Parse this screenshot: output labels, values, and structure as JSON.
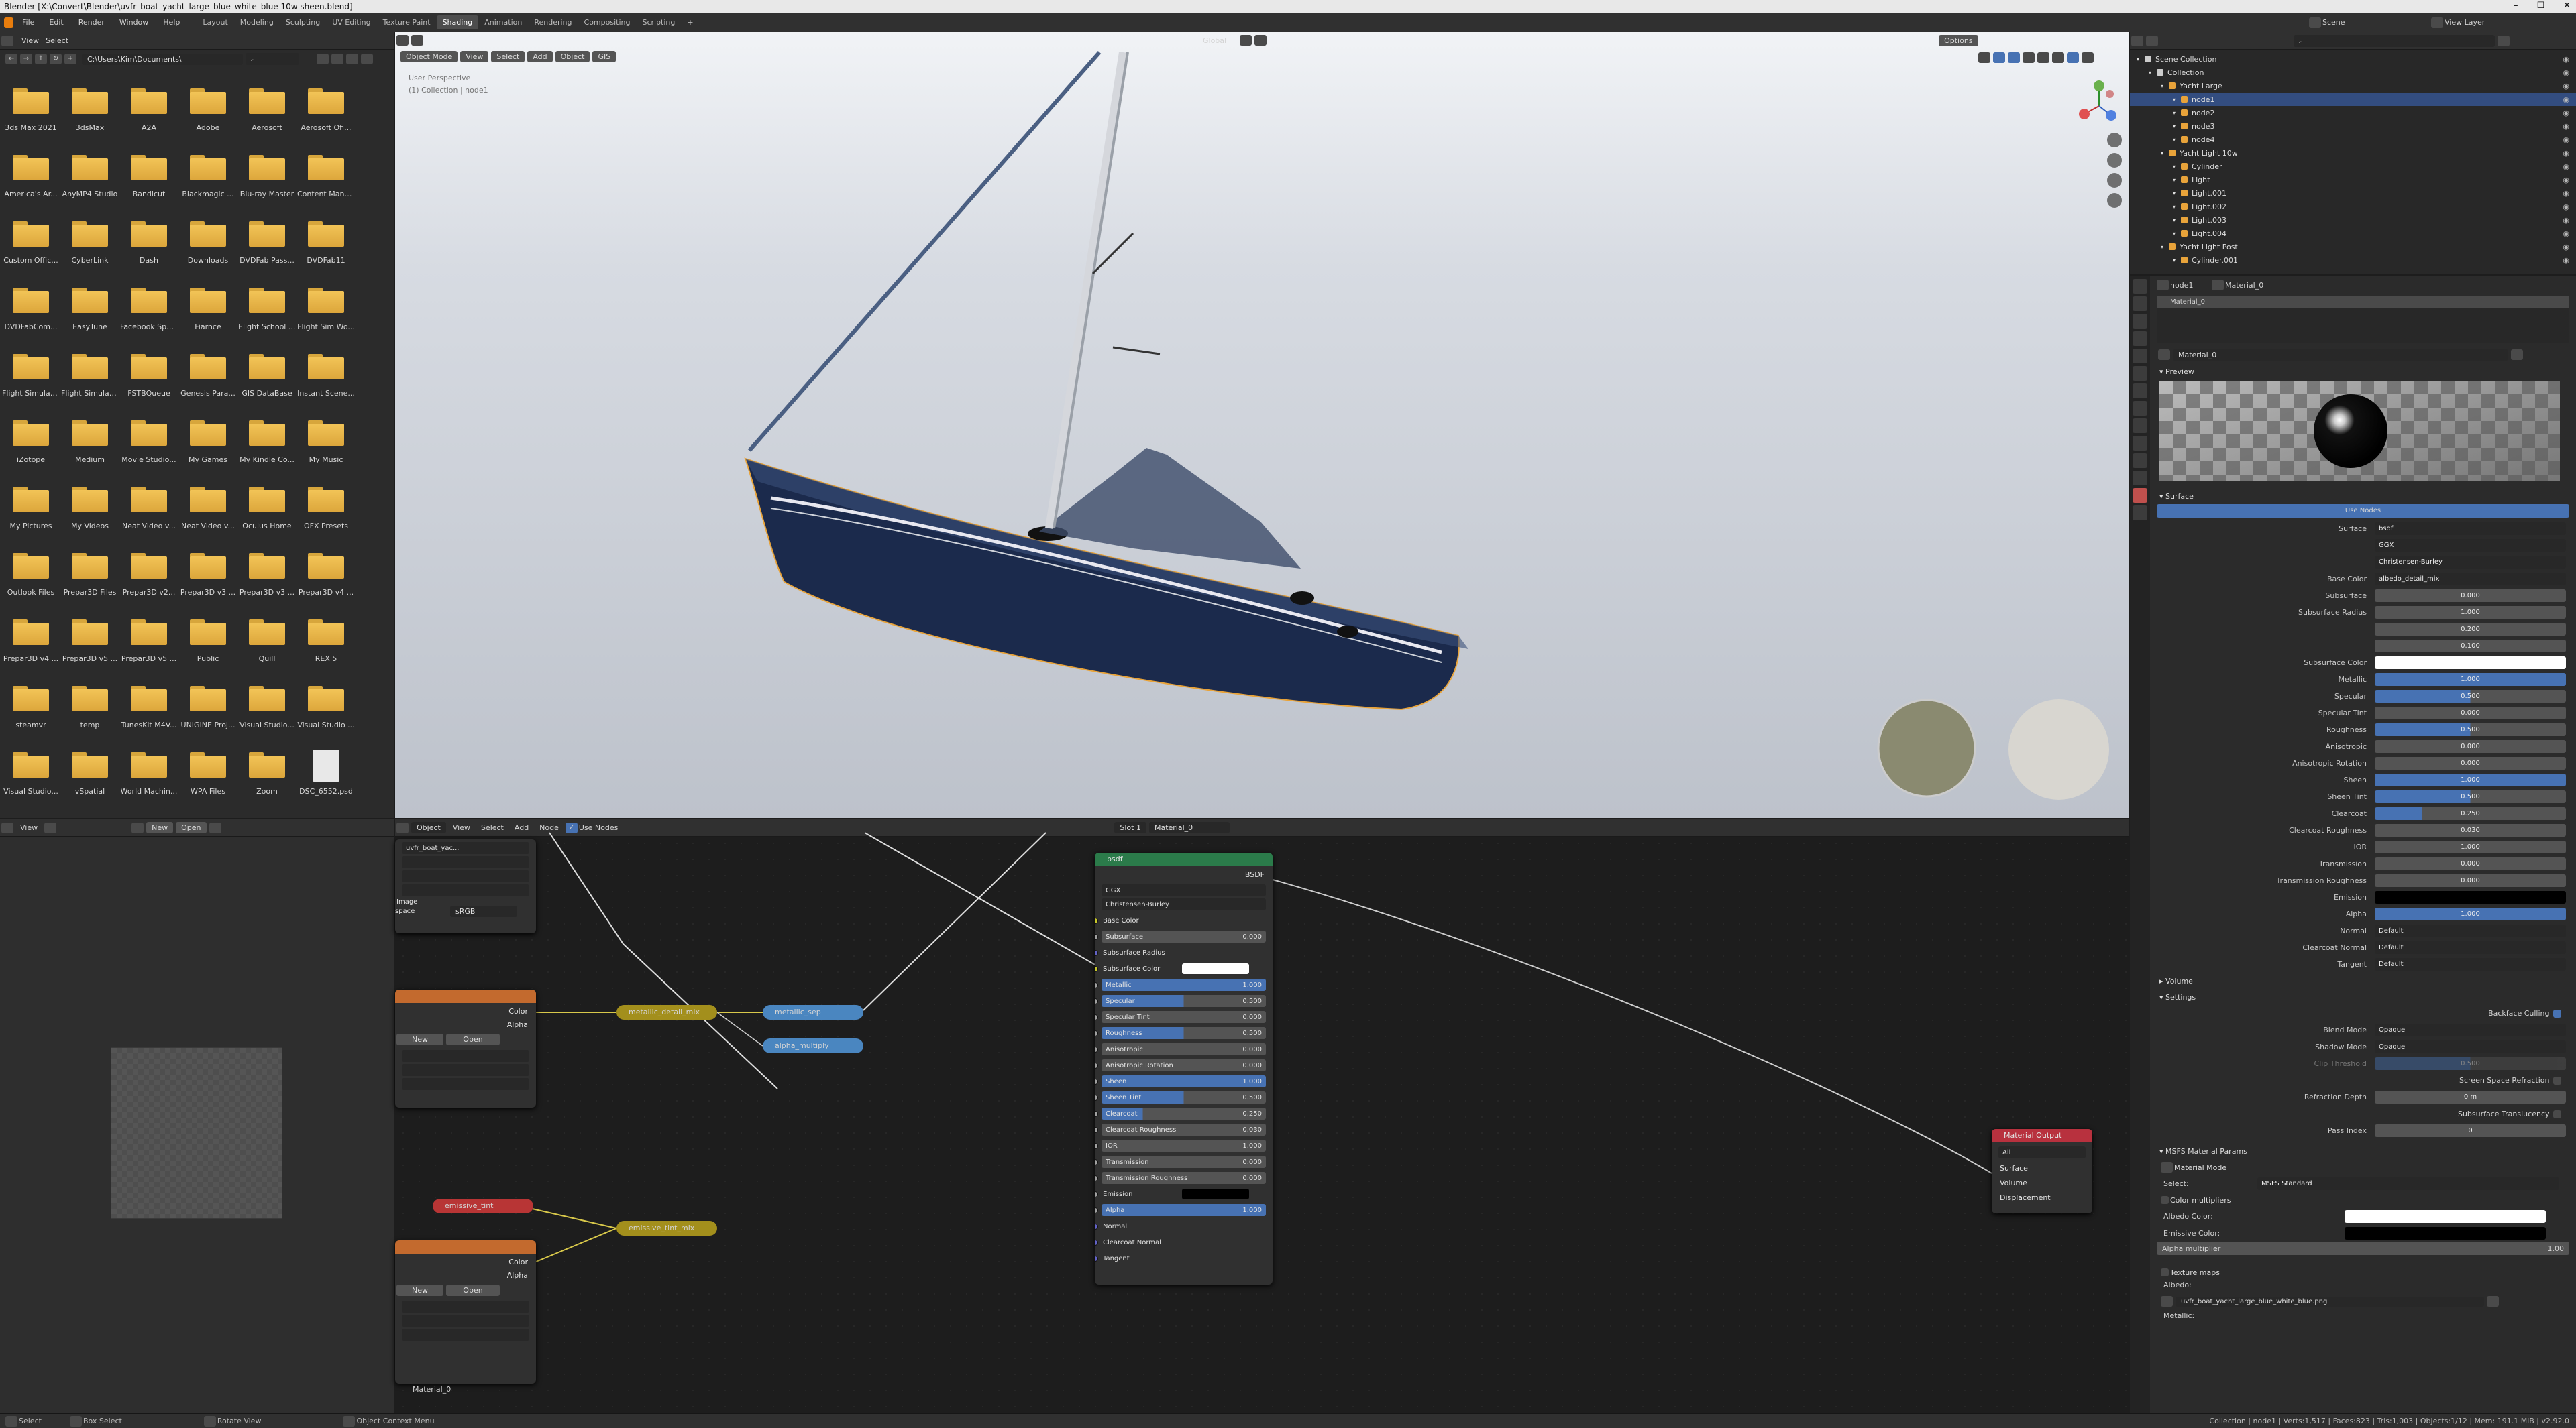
{
  "window": {
    "title": "Blender [X:\\Convert\\Blender\\uvfr_boat_yacht_large_blue_white_blue 10w sheen.blend]",
    "controls": [
      "–",
      "☐",
      "✕"
    ]
  },
  "topbar": {
    "menus": [
      "File",
      "Edit",
      "Render",
      "Window",
      "Help"
    ],
    "workspaces": [
      "Layout",
      "Modeling",
      "Sculpting",
      "UV Editing",
      "Texture Paint",
      "Shading",
      "Animation",
      "Rendering",
      "Compositing",
      "Scripting"
    ],
    "active_workspace": "Shading",
    "scene_label": "Scene",
    "view_layer_label": "View Layer"
  },
  "filebrowser": {
    "menus": [
      "View",
      "Select"
    ],
    "path": "C:\\Users\\Kim\\Documents\\",
    "folders": [
      "3ds Max 2021",
      "3dsMax",
      "A2A",
      "Adobe",
      "Aerosoft",
      "Aerosoft Ofi...",
      "America's Ar...",
      "AnyMP4 Studio",
      "Bandicut",
      "Blackmagic ...",
      "Blu-ray Master",
      "Content Mana...",
      "Custom Offic...",
      "CyberLink",
      "Dash",
      "Downloads",
      "DVDFab Pass...",
      "DVDFab11",
      "DVDFabCom...",
      "EasyTune",
      "Facebook Spa...",
      "Fiarnce",
      "Flight School ...",
      "Flight Sim Wo...",
      "Flight Simulat...",
      "Flight Simulat...",
      "FSTBQueue",
      "Genesis Para...",
      "GIS DataBase",
      "Instant Scene...",
      "iZotope",
      "Medium",
      "Movie Studio...",
      "My Games",
      "My Kindle Co...",
      "My Music",
      "My Pictures",
      "My Videos",
      "Neat Video v...",
      "Neat Video v...",
      "Oculus Home",
      "OFX Presets",
      "Outlook Files",
      "Prepar3D Files",
      "Prepar3D v2...",
      "Prepar3D v3 ...",
      "Prepar3D v3 ...",
      "Prepar3D v4 ...",
      "Prepar3D v4 ...",
      "Prepar3D v5 ...",
      "Prepar3D v5 ...",
      "Public",
      "Quill",
      "REX 5",
      "steamvr",
      "temp",
      "TunesKit M4V...",
      "UNIGINE Proj...",
      "Visual Studio...",
      "Visual Studio ...",
      "Visual Studio...",
      "vSpatial",
      "World Machin...",
      "WPA Files",
      "Zoom"
    ],
    "file": "DSC_6552.psd"
  },
  "image_editor": {
    "view": "View",
    "new": "New",
    "open": "Open"
  },
  "viewport": {
    "mode": "Object Mode",
    "menus": [
      "View",
      "Select",
      "Add",
      "Object"
    ],
    "gis": "GIS",
    "info1": "User Perspective",
    "info2": "(1) Collection | node1",
    "orientation": "Global",
    "options": "Options",
    "nav_axes": [
      "X",
      "Y",
      "Z"
    ]
  },
  "node_editor": {
    "mode": "Object",
    "menus": [
      "View",
      "Select",
      "Add",
      "Node"
    ],
    "use_nodes": "Use Nodes",
    "slot": "Slot 1",
    "material": "Material_0",
    "tex_name": "uvfr_boat_yac...",
    "colorspace_label": "Image",
    "colorspace": "sRGB",
    "space_label": "space",
    "new": "New",
    "open": "Open",
    "color": "Color",
    "alpha": "Alpha",
    "material_footer": "Material_0",
    "reroutes": [
      "metallic_detail_mix",
      "metallic_sep",
      "alpha_multiply",
      "emissive_tint",
      "emissive_tint_mix"
    ],
    "bsdf": {
      "title": "bsdf",
      "out": "BSDF",
      "dist": "GGX",
      "sss": "Christensen-Burley",
      "rows": [
        [
          "Base Color",
          ""
        ],
        [
          "Subsurface",
          "0.000"
        ],
        [
          "Subsurface Radius",
          ""
        ],
        [
          "Subsurface Color",
          ""
        ],
        [
          "Metallic",
          "1.000"
        ],
        [
          "Specular",
          "0.500"
        ],
        [
          "Specular Tint",
          "0.000"
        ],
        [
          "Roughness",
          "0.500"
        ],
        [
          "Anisotropic",
          "0.000"
        ],
        [
          "Anisotropic Rotation",
          "0.000"
        ],
        [
          "Sheen",
          "1.000"
        ],
        [
          "Sheen Tint",
          "0.500"
        ],
        [
          "Clearcoat",
          "0.250"
        ],
        [
          "Clearcoat Roughness",
          "0.030"
        ],
        [
          "IOR",
          "1.000"
        ],
        [
          "Transmission",
          "0.000"
        ],
        [
          "Transmission Roughness",
          "0.000"
        ],
        [
          "Emission",
          ""
        ],
        [
          "Alpha",
          "1.000"
        ],
        [
          "Normal",
          ""
        ],
        [
          "Clearcoat Normal",
          ""
        ],
        [
          "Tangent",
          ""
        ]
      ]
    },
    "output": {
      "title": "Material Output",
      "target": "All",
      "sockets": [
        "Surface",
        "Volume",
        "Displacement"
      ]
    }
  },
  "outliner": {
    "items": [
      {
        "label": "Scene Collection",
        "d": 0
      },
      {
        "label": "Collection",
        "d": 1
      },
      {
        "label": "Yacht Large",
        "d": 2
      },
      {
        "label": "node1",
        "d": 3,
        "sel": true
      },
      {
        "label": "node2",
        "d": 3
      },
      {
        "label": "node3",
        "d": 3
      },
      {
        "label": "node4",
        "d": 3
      },
      {
        "label": "Yacht Light 10w",
        "d": 2
      },
      {
        "label": "Cylinder",
        "d": 3
      },
      {
        "label": "Light",
        "d": 3
      },
      {
        "label": "Light.001",
        "d": 3
      },
      {
        "label": "Light.002",
        "d": 3
      },
      {
        "label": "Light.003",
        "d": 3
      },
      {
        "label": "Light.004",
        "d": 3
      },
      {
        "label": "Yacht Light Post",
        "d": 2
      },
      {
        "label": "Cylinder.001",
        "d": 3
      }
    ]
  },
  "properties": {
    "crumb_obj": "node1",
    "crumb_mat": "Material_0",
    "slot_item": "Material_0",
    "mat_name": "Material_0",
    "preview": "Preview",
    "surface": "Surface",
    "use_nodes": "Use Nodes",
    "rows": [
      [
        "Surface",
        "bsdf",
        "dd"
      ],
      [
        "",
        "GGX",
        "dd"
      ],
      [
        "",
        "Christensen-Burley",
        "dd"
      ],
      [
        "Base Color",
        "albedo_detail_mix",
        "dd"
      ],
      [
        "Subsurface",
        "0.000",
        ""
      ],
      [
        "Subsurface Radius",
        "1.000",
        ""
      ],
      [
        "",
        "0.200",
        ""
      ],
      [
        "",
        "0.100",
        ""
      ],
      [
        "Subsurface Color",
        "",
        "white"
      ],
      [
        "Metallic",
        "1.000",
        "bar100"
      ],
      [
        "Specular",
        "0.500",
        "bar50"
      ],
      [
        "Specular Tint",
        "0.000",
        ""
      ],
      [
        "Roughness",
        "0.500",
        "bar50"
      ],
      [
        "Anisotropic",
        "0.000",
        ""
      ],
      [
        "Anisotropic Rotation",
        "0.000",
        ""
      ],
      [
        "Sheen",
        "1.000",
        "bar100"
      ],
      [
        "Sheen Tint",
        "0.500",
        "bar50"
      ],
      [
        "Clearcoat",
        "0.250",
        "bar25"
      ],
      [
        "Clearcoat Roughness",
        "0.030",
        ""
      ],
      [
        "IOR",
        "1.000",
        ""
      ],
      [
        "Transmission",
        "0.000",
        ""
      ],
      [
        "Transmission Roughness",
        "0.000",
        ""
      ],
      [
        "Emission",
        "",
        "black"
      ],
      [
        "Alpha",
        "1.000",
        "bar100"
      ],
      [
        "Normal",
        "Default",
        "dd"
      ],
      [
        "Clearcoat Normal",
        "Default",
        "dd"
      ],
      [
        "Tangent",
        "Default",
        "dd"
      ]
    ],
    "volume": "Volume",
    "settings": "Settings",
    "backface": "Backface Culling",
    "blend_label": "Blend Mode",
    "blend": "Opaque",
    "shadow_label": "Shadow Mode",
    "shadow": "Opaque",
    "clip_label": "Clip Threshold",
    "clip": "0.500",
    "ssr": "Screen Space Refraction",
    "refr_label": "Refraction Depth",
    "refr": "0 m",
    "sst": "Subsurface Translucency",
    "pass_label": "Pass Index",
    "pass": "0",
    "msfs": "MSFS Material Params",
    "mat_mode": "Material Mode",
    "select_label": "Select:",
    "select": "MSFS Standard",
    "color_mult": "Color multipliers",
    "albedo_color": "Albedo Color:",
    "emissive_color": "Emissive Color:",
    "alpha_mult": "Alpha multiplier",
    "alpha_mult_val": "1.00",
    "tex_maps": "Texture maps",
    "albedo": "Albedo:",
    "albedo_tex": "uvfr_boat_yacht_large_blue_white_blue.png",
    "metallic": "Metallic:"
  },
  "status": {
    "select": "Select",
    "box": "Box Select",
    "rotate": "Rotate View",
    "ctx": "Object Context Menu",
    "stats": "Collection | node1 | Verts:1,517 | Faces:823 | Tris:1,003 | Objects:1/12 | Mem: 191.1 MiB | v2.92.0"
  },
  "colors": {
    "accent": "#4772b3",
    "selection": "#334d80",
    "bsdf_header": "#2b7b4a",
    "reroute_yellow": "#a38f1c",
    "reroute_blue": "#4a86c0",
    "reroute_red": "#b83535",
    "texture_header": "#c36a2e",
    "output_header": "#b8313e"
  }
}
